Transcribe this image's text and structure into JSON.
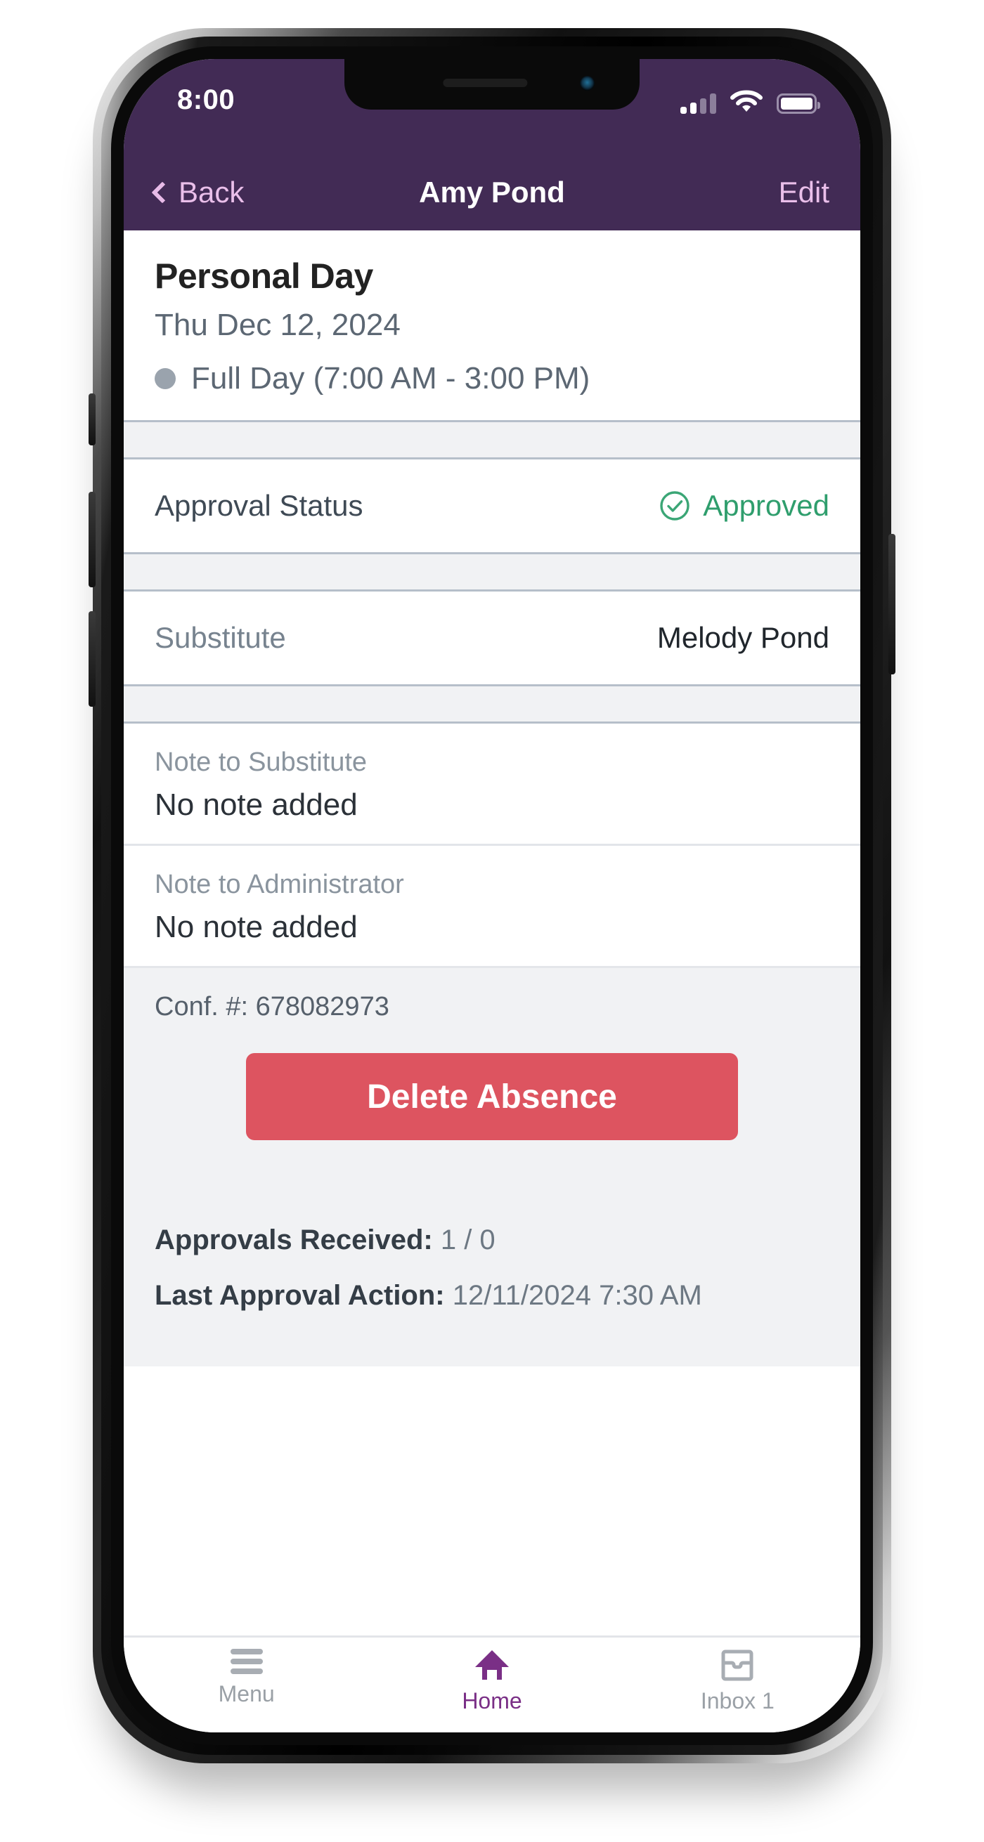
{
  "status_bar": {
    "time": "8:00",
    "signal_icon": "signal-bars-icon",
    "wifi_icon": "wifi-icon",
    "battery_icon": "battery-icon"
  },
  "nav_bar": {
    "back_label": "Back",
    "back_icon": "chevron-left-icon",
    "title": "Amy Pond",
    "edit_label": "Edit"
  },
  "absence": {
    "type": "Personal Day",
    "date": "Thu Dec 12, 2024",
    "duration": "Full Day (7:00 AM - 3:00 PM)",
    "duration_bullet_icon": "dot-icon"
  },
  "approval": {
    "label": "Approval Status",
    "value": "Approved",
    "icon": "check-circle-icon",
    "color": "#2f9e6d"
  },
  "substitute": {
    "label": "Substitute",
    "value": "Melody Pond"
  },
  "notes": [
    {
      "label": "Note to Substitute",
      "value": "No note added"
    },
    {
      "label": "Note to Administrator",
      "value": "No note added"
    }
  ],
  "footer": {
    "conf_label": "Conf. #: 678082973",
    "delete_button": "Delete Absence",
    "delete_color": "#dd5460",
    "approvals_received_label": "Approvals Received:",
    "approvals_received_value": "1 / 0",
    "last_action_label": "Last Approval Action:",
    "last_action_value": "12/11/2024 7:30 AM"
  },
  "tab_bar": {
    "tabs": [
      {
        "label": "Menu",
        "icon": "hamburger-menu-icon",
        "active": false
      },
      {
        "label": "Home",
        "icon": "home-icon",
        "active": true
      },
      {
        "label": "Inbox 1",
        "icon": "inbox-icon",
        "active": false
      }
    ]
  },
  "theme": {
    "nav_purple": "#422b55",
    "accent_purple": "#7a2f86",
    "link_pink": "#eabfea"
  }
}
